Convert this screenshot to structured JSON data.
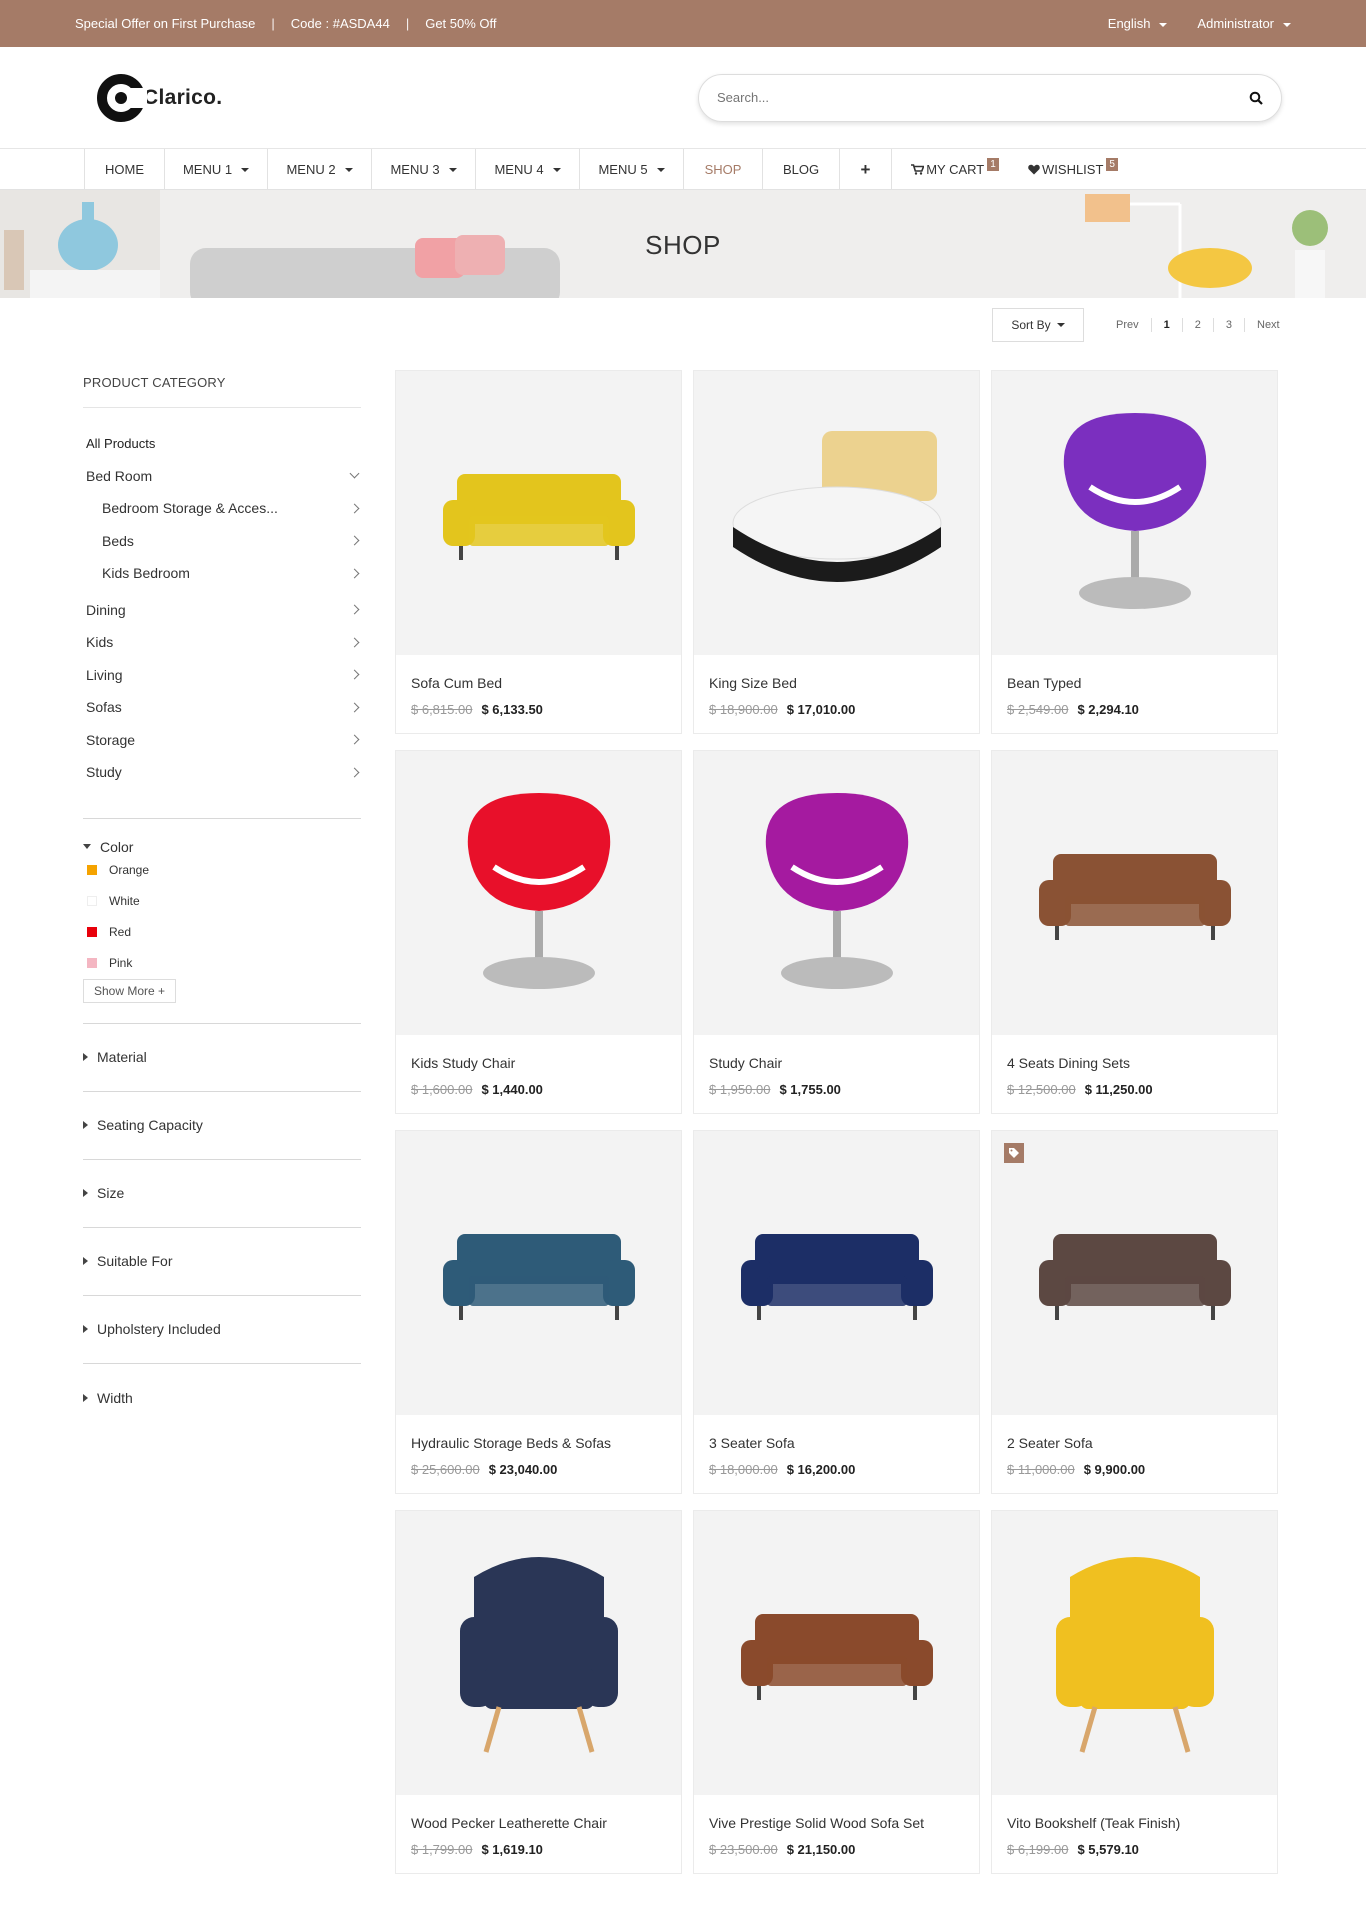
{
  "topbar": {
    "offer": "Special Offer on First Purchase",
    "code": "Code : #ASDA44",
    "discount": "Get 50% Off",
    "language": "English",
    "account": "Administrator"
  },
  "header": {
    "logo_text": "Clarico.",
    "search_placeholder": "Search..."
  },
  "nav": {
    "items": [
      {
        "label": "HOME"
      },
      {
        "label": "MENU 1"
      },
      {
        "label": "MENU 2"
      },
      {
        "label": "MENU 3"
      },
      {
        "label": "MENU 4"
      },
      {
        "label": "MENU 5"
      },
      {
        "label": "SHOP"
      },
      {
        "label": "BLOG"
      },
      {
        "label": "+"
      },
      {
        "label": "MY CART",
        "count": "1"
      },
      {
        "label": "WISHLIST",
        "count": "5"
      }
    ]
  },
  "banner": {
    "title": "SHOP"
  },
  "toolbar": {
    "sort_label": "Sort By",
    "prev": "Prev",
    "pages": [
      "1",
      "2",
      "3"
    ],
    "next": "Next"
  },
  "sidebar": {
    "category_title": "PRODUCT CATEGORY",
    "categories": [
      {
        "label": "All Products"
      },
      {
        "label": "Bed Room"
      },
      {
        "label": "Bedroom Storage & Acces..."
      },
      {
        "label": "Beds"
      },
      {
        "label": "Kids Bedroom"
      },
      {
        "label": "Dining"
      },
      {
        "label": "Kids"
      },
      {
        "label": "Living"
      },
      {
        "label": "Sofas"
      },
      {
        "label": "Storage"
      },
      {
        "label": "Study"
      }
    ],
    "color_title": "Color",
    "colors": [
      {
        "label": "Orange",
        "hex": "#f5a300"
      },
      {
        "label": "White",
        "hex": "#ffffff"
      },
      {
        "label": "Red",
        "hex": "#e8000b"
      },
      {
        "label": "Pink",
        "hex": "#f4b6c2"
      }
    ],
    "show_more": "Show More +",
    "filters": [
      "Material",
      "Seating Capacity",
      "Size",
      "Suitable For",
      "Upholstery Included",
      "Width"
    ]
  },
  "products": [
    {
      "name": "Sofa Cum Bed",
      "old": "$ 6,815.00",
      "price": "$ 6,133.50",
      "icon": "sofa-icon",
      "color": "#e3c51d"
    },
    {
      "name": "King Size Bed",
      "old": "$ 18,900.00",
      "price": "$ 17,010.00",
      "icon": "bed-icon",
      "color": "#ecd28f"
    },
    {
      "name": "Bean Typed",
      "old": "$ 2,549.00",
      "price": "$ 2,294.10",
      "icon": "chair-icon",
      "color": "#7b2fbf"
    },
    {
      "name": "Kids Study Chair",
      "old": "$ 1,600.00",
      "price": "$ 1,440.00",
      "icon": "chair-icon",
      "color": "#e8102a"
    },
    {
      "name": "Study Chair",
      "old": "$ 1,950.00",
      "price": "$ 1,755.00",
      "icon": "chair-icon",
      "color": "#a51aa0"
    },
    {
      "name": "4 Seats Dining Sets",
      "old": "$ 12,500.00",
      "price": "$ 11,250.00",
      "icon": "sofa-icon",
      "color": "#8a5234"
    },
    {
      "name": "Hydraulic Storage Beds & Sofas",
      "old": "$ 25,600.00",
      "price": "$ 23,040.00",
      "icon": "sofa-icon",
      "color": "#2e5b78"
    },
    {
      "name": "3 Seater Sofa",
      "old": "$ 18,000.00",
      "price": "$ 16,200.00",
      "icon": "sofa-icon",
      "color": "#1c2e66"
    },
    {
      "name": "2 Seater Sofa",
      "old": "$ 11,000.00",
      "price": "$ 9,900.00",
      "icon": "sofa-icon",
      "color": "#5c4842",
      "tag": true
    },
    {
      "name": "Wood Pecker Leatherette Chair",
      "old": "$ 1,799.00",
      "price": "$ 1,619.10",
      "icon": "armchair-icon",
      "color": "#2a3656"
    },
    {
      "name": "Vive Prestige Solid Wood Sofa Set",
      "old": "$ 23,500.00",
      "price": "$ 21,150.00",
      "icon": "sofa-icon",
      "color": "#8a4a2c"
    },
    {
      "name": "Vito Bookshelf (Teak Finish)",
      "old": "$ 6,199.00",
      "price": "$ 5,579.10",
      "icon": "armchair-icon",
      "color": "#f0c020"
    }
  ],
  "theme": {
    "accent": "#a57b67"
  }
}
